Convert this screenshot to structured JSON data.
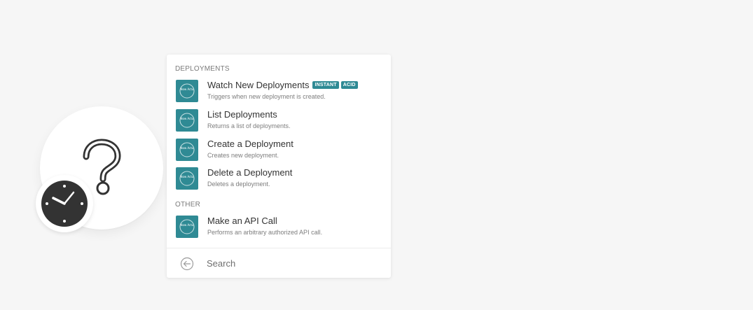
{
  "module": {
    "icon": "question-mark-icon",
    "badge_icon": "clock-icon"
  },
  "panel": {
    "sections": [
      {
        "header": "DEPLOYMENTS",
        "items": [
          {
            "title": "Watch New Deployments",
            "description": "Triggers when new deployment is created.",
            "badges": [
              "INSTANT",
              "ACID"
            ]
          },
          {
            "title": "List Deployments",
            "description": "Returns a list of deployments."
          },
          {
            "title": "Create a Deployment",
            "description": "Creates new deployment."
          },
          {
            "title": "Delete a Deployment",
            "description": "Deletes a deployment."
          }
        ]
      },
      {
        "header": "OTHER",
        "items": [
          {
            "title": "Make an API Call",
            "description": "Performs an arbitrary authorized API call."
          }
        ]
      }
    ],
    "app_icon_text": "Now Actu",
    "search_label": "Search",
    "accent_color": "#2f8a94"
  }
}
